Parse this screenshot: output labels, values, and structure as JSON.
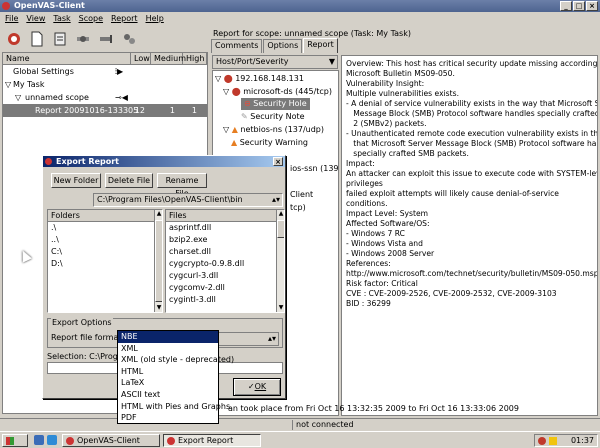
{
  "window": {
    "title": "OpenVAS-Client"
  },
  "menu": [
    "File",
    "View",
    "Task",
    "Scope",
    "Report",
    "Help"
  ],
  "toolbar": [
    "connect-icon",
    "new-icon",
    "open-icon",
    "plugins-icon",
    "settings-icon",
    "scan-icon"
  ],
  "tree": {
    "headers": {
      "name": "Name",
      "low": "Low",
      "medium": "Medium",
      "high": "High"
    },
    "rows": [
      {
        "label": "Global Settings",
        "indent": 0
      },
      {
        "label": "My Task",
        "indent": 0,
        "expander": "▽"
      },
      {
        "label": "unnamed scope",
        "indent": 1,
        "expander": "▽"
      },
      {
        "label": "Report 20091016-133305",
        "indent": 2,
        "low": "12",
        "medium": "1",
        "high": "1",
        "selected": true
      }
    ]
  },
  "right": {
    "title": "Report for scope: unnamed scope (Task: My Task)",
    "tabs": [
      "Comments",
      "Options",
      "Report"
    ],
    "active_tab": "Report",
    "host_port_severity": "Host/Port/Severity",
    "tree": [
      {
        "label": "192.168.148.131",
        "level": 0,
        "icon": "high"
      },
      {
        "label": "microsoft-ds (445/tcp)",
        "level": 1,
        "icon": "high"
      },
      {
        "label": "Security Hole",
        "level": 2,
        "icon": "hole",
        "selected": true
      },
      {
        "label": "Security Note",
        "level": 2,
        "icon": "note"
      },
      {
        "label": "netbios-ns (137/udp)",
        "level": 1,
        "icon": "warning"
      },
      {
        "label": "Security Warning",
        "level": 2,
        "icon": "warning"
      },
      {
        "label": "ios-ssn (139/tcp)",
        "level": 1,
        "icon": "note"
      },
      {
        "label": "Client",
        "level": 1,
        "icon": "none"
      },
      {
        "label": "tcp)",
        "level": 1,
        "icon": "none"
      }
    ],
    "report_lines": [
      "Overview: This host has critical security update missing according to",
      "Microsoft Bulletin MS09-050.",
      "",
      "Vulnerability Insight:",
      "Multiple vulnerabilities exists.",
      "- A denial of service vulnerability exists in the way that Microsoft Server",
      "   Message Block (SMB) Protocol software handles specially crafted SMB",
      "   2 (SMBv2) packets.",
      "- Unauthenticated remote code execution vulnerability exists in the way",
      "   that Microsoft Server Message Block (SMB) Protocol software handles",
      "   specially crafted SMB packets.",
      "",
      "Impact:",
      "An attacker can exploit this issue to execute code with SYSTEM-level",
      "privileges",
      "failed exploit attempts will likely cause denial-of-service",
      "conditions.",
      "",
      "Impact Level: System",
      "",
      "Affected Software/OS:",
      "- Windows 7 RC",
      "- Windows Vista and",
      "- Windows 2008 Server",
      "",
      "References:",
      "http://www.microsoft.com/technet/security/bulletin/MS09-050.mspx",
      "",
      "Risk factor: Critical",
      "CVE : CVE-2009-2526, CVE-2009-2532, CVE-2009-3103",
      "BID : 36299"
    ],
    "scan_time": "an took place from Fri Oct 16 13:32:35 2009 to Fri Oct 16 13:33:06 2009"
  },
  "status": {
    "connection": "not connected"
  },
  "taskbar": {
    "items": [
      "OpenVAS-Client",
      "Export Report"
    ],
    "active": "Export Report",
    "time": "01:37"
  },
  "dialog": {
    "title": "Export Report",
    "buttons": {
      "new_folder": "New Folder",
      "delete_file": "Delete File",
      "rename_file": "Rename File"
    },
    "path": "C:\\Program Files\\OpenVAS-Client\\bin",
    "folders_header": "Folders",
    "files_header": "Files",
    "folders": [
      ".\\",
      "..\\",
      "C:\\",
      "D:\\"
    ],
    "files": [
      "asprintf.dll",
      "bzip2.exe",
      "charset.dll",
      "cygcrypto-0.9.8.dll",
      "cygcurl-3.dll",
      "cygcomv-2.dll",
      "cygintl-3.dll"
    ],
    "export_options_label": "Export Options",
    "format_label": "Report file format",
    "selection_label": "Selection: C:\\Program",
    "ok_label": "OK",
    "formats": [
      "NBE",
      "XML",
      "XML (old style - deprecated)",
      "HTML",
      "LaTeX",
      "ASCII text",
      "HTML with Pies and Graphs",
      "PDF"
    ],
    "selected_format": "NBE"
  }
}
